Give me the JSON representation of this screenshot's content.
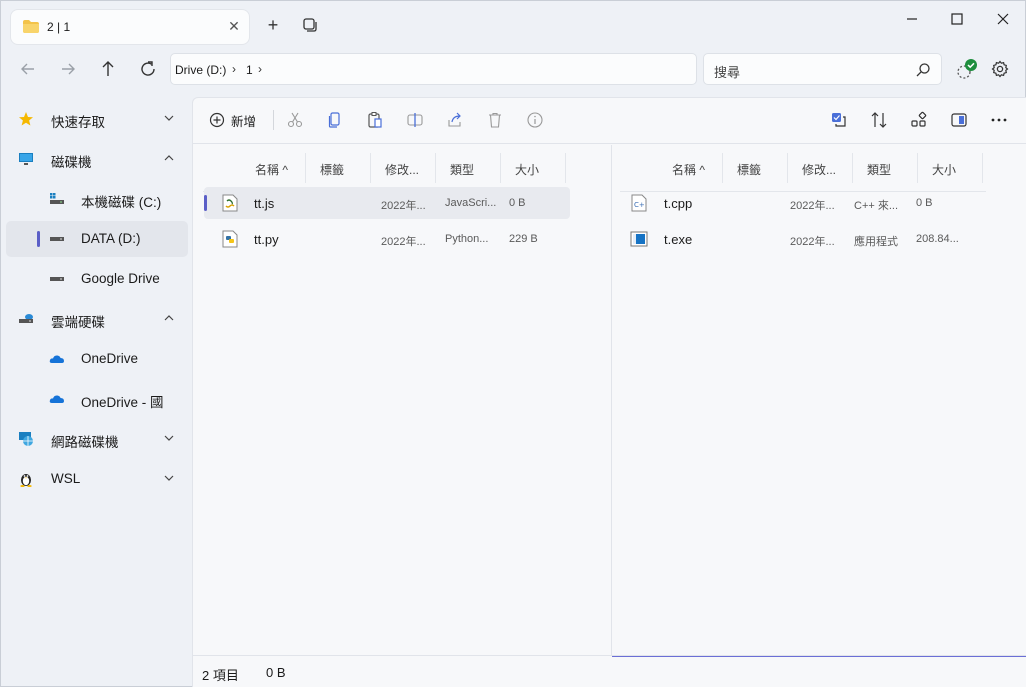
{
  "tab": {
    "title": "2 | 1"
  },
  "nav": {
    "breadcrumbs": [
      "Drive (D:)",
      "1"
    ],
    "search_placeholder": "搜尋"
  },
  "sidebar": {
    "items": [
      {
        "label": "快速存取",
        "icon": "star-icon"
      },
      {
        "label": "磁碟機",
        "icon": "monitor-icon"
      },
      {
        "label": "本機磁碟 (C:)",
        "icon": "windows-drive-icon"
      },
      {
        "label": "DATA (D:)",
        "icon": "drive-icon"
      },
      {
        "label": "Google Drive",
        "icon": "drive-icon"
      },
      {
        "label": "雲端硬碟",
        "icon": "cloud-drive-icon"
      },
      {
        "label": "OneDrive",
        "icon": "onedrive-icon"
      },
      {
        "label": "OneDrive - 國",
        "icon": "onedrive-icon"
      },
      {
        "label": "網路磁碟機",
        "icon": "network-icon"
      },
      {
        "label": "WSL",
        "icon": "linux-icon"
      }
    ]
  },
  "toolbar": {
    "new_label": "新增"
  },
  "columns": {
    "name": "名稱",
    "tags": "標籤",
    "modified": "修改...",
    "type": "類型",
    "size": "大小"
  },
  "left_pane": {
    "files": [
      {
        "name": "tt.js",
        "modified": "2022年...",
        "type": "JavaScri...",
        "size": "0 B",
        "icon": "js-file-icon"
      },
      {
        "name": "tt.py",
        "modified": "2022年...",
        "type": "Python...",
        "size": "229 B",
        "icon": "py-file-icon"
      }
    ]
  },
  "right_pane": {
    "files": [
      {
        "name": "t.cpp",
        "modified": "2022年...",
        "type": "C++ 來...",
        "size": "0 B",
        "icon": "cpp-file-icon"
      },
      {
        "name": "t.exe",
        "modified": "2022年...",
        "type": "應用程式",
        "size": "208.84...",
        "icon": "exe-file-icon"
      }
    ]
  },
  "status": {
    "items": "2 項目",
    "size": "0 B"
  },
  "colors": {
    "accent": "#5b5fc7",
    "sync_ok": "#1e8e3e"
  }
}
